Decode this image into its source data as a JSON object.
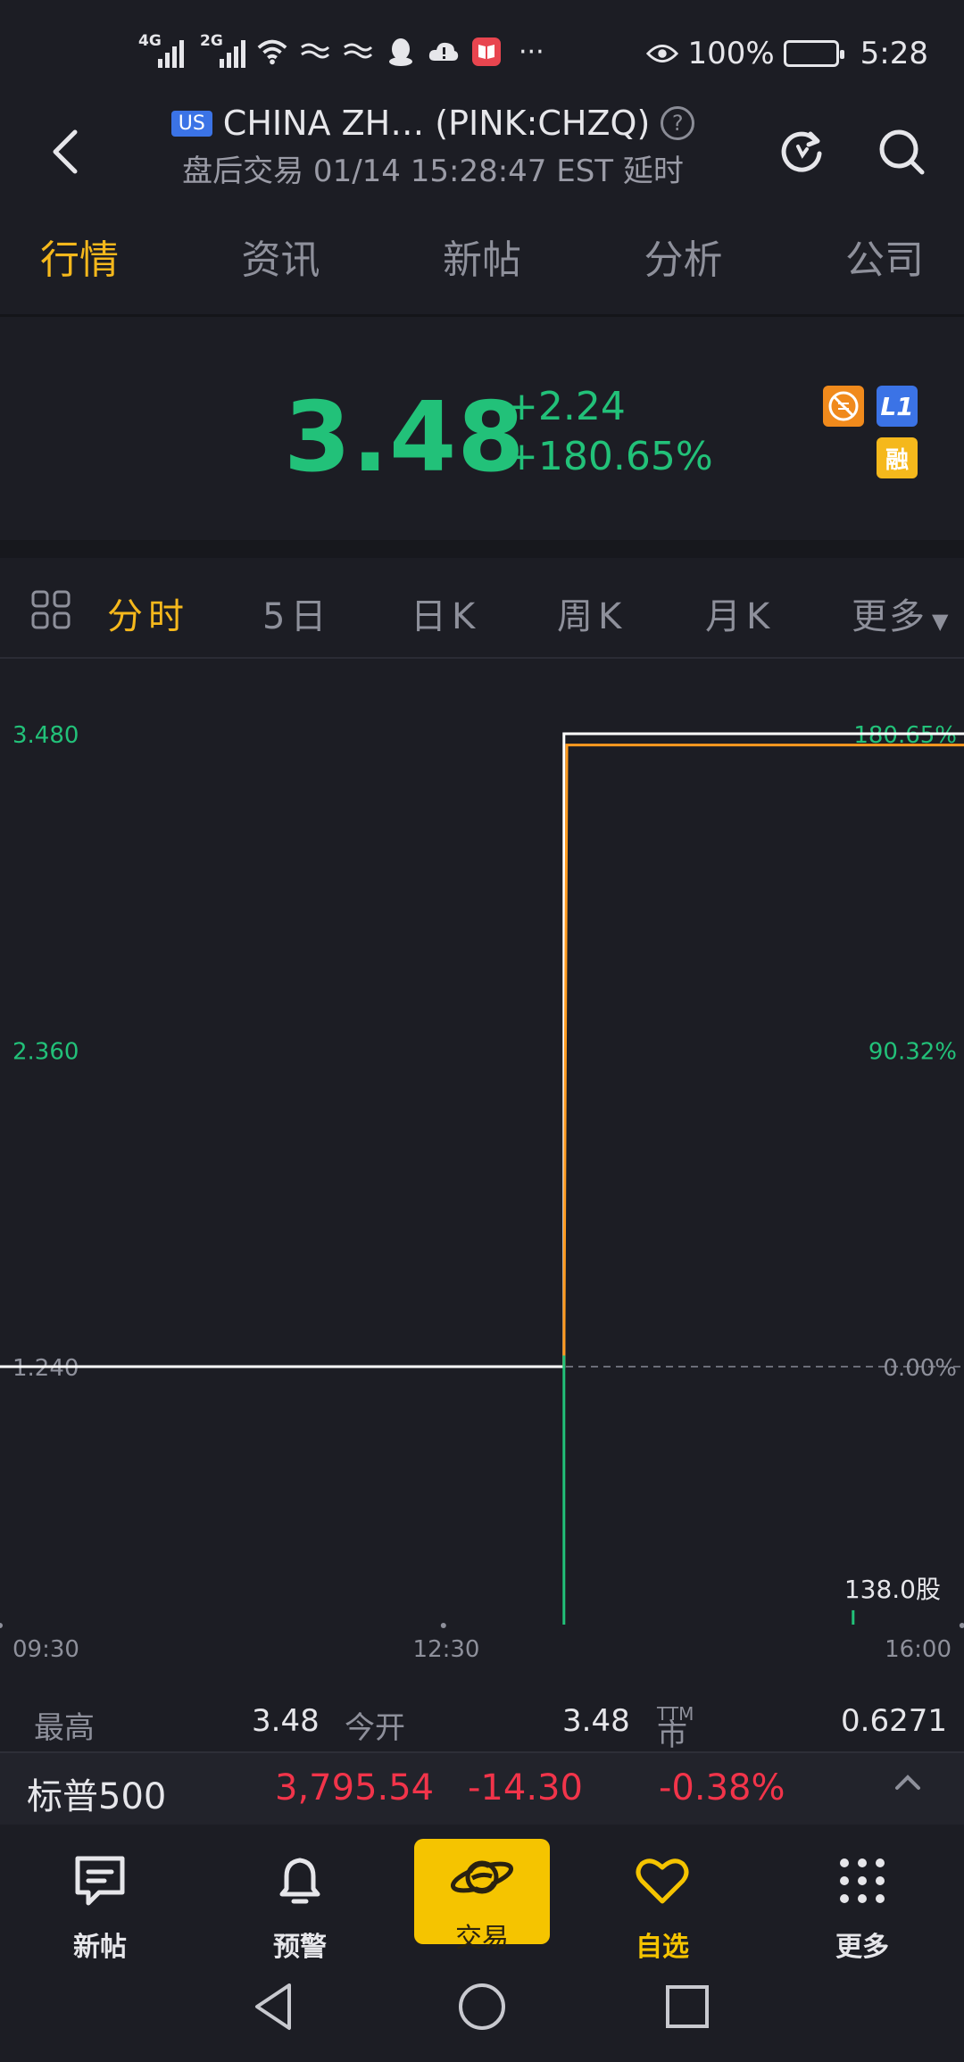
{
  "status_bar": {
    "signal1_tag": "4G",
    "signal2_tag": "2G",
    "more": "···",
    "battery": "100%",
    "time": "5:28"
  },
  "header": {
    "market_badge": "US",
    "title": "CHINA ZH… (PINK:CHZQ)",
    "subtitle": "盘后交易 01/14 15:28:47 EST 延时"
  },
  "tabs": [
    {
      "label": "行情",
      "active": true
    },
    {
      "label": "资讯"
    },
    {
      "label": "新帖"
    },
    {
      "label": "分析"
    },
    {
      "label": "公司"
    }
  ],
  "quote": {
    "price": "3.48",
    "change": "+2.24",
    "change_pct": "+180.65%",
    "badge_l1": "L1",
    "badge_margin": "融",
    "up_color": "#22c179"
  },
  "periods": [
    {
      "label": "分时",
      "active": true
    },
    {
      "label": "5日"
    },
    {
      "label": "日K"
    },
    {
      "label": "周K"
    },
    {
      "label": "月K"
    },
    {
      "label": "更多"
    }
  ],
  "chart_data": {
    "type": "line",
    "y_left_labels": [
      "3.480",
      "2.360",
      "1.240"
    ],
    "y_right_labels": [
      "180.65%",
      "90.32%",
      "0.00%"
    ],
    "x_labels": [
      "09:30",
      "12:30",
      "16:00"
    ],
    "ylim": [
      1.24,
      3.48
    ],
    "prev_close": 1.24,
    "series": [
      {
        "values": [
          [
            0.0,
            1.24
          ],
          [
            0.585,
            1.24
          ],
          [
            0.585,
            3.48
          ],
          [
            1.0,
            3.48
          ]
        ]
      },
      {
        "values": [
          [
            0.585,
            1.24
          ],
          [
            0.588,
            3.44
          ],
          [
            1.0,
            3.44
          ]
        ]
      }
    ],
    "volume_label": "138.0股",
    "volumes": [
      [
        0.585,
        0.75
      ],
      [
        0.885,
        0.04
      ]
    ],
    "colors": {
      "price": "#ffffff",
      "avg": "#ff9a1f",
      "grid": "#6c6e78",
      "volume": "#22c179"
    }
  },
  "stats": {
    "high_label": "最高",
    "high_value": "3.48",
    "open_label": "今开",
    "open_value": "3.48",
    "pe_label": "市盈率",
    "pe_sup": "TTM",
    "pe_value": "0.6271"
  },
  "index_bar": {
    "name": "标普500",
    "value": "3,795.54",
    "change": "-14.30",
    "change_pct": "-0.38%",
    "down_color": "#f2344a"
  },
  "bottom_nav": [
    {
      "label": "新帖"
    },
    {
      "label": "预警"
    },
    {
      "label": "交易"
    },
    {
      "label": "自选",
      "active": true
    },
    {
      "label": "更多"
    }
  ]
}
